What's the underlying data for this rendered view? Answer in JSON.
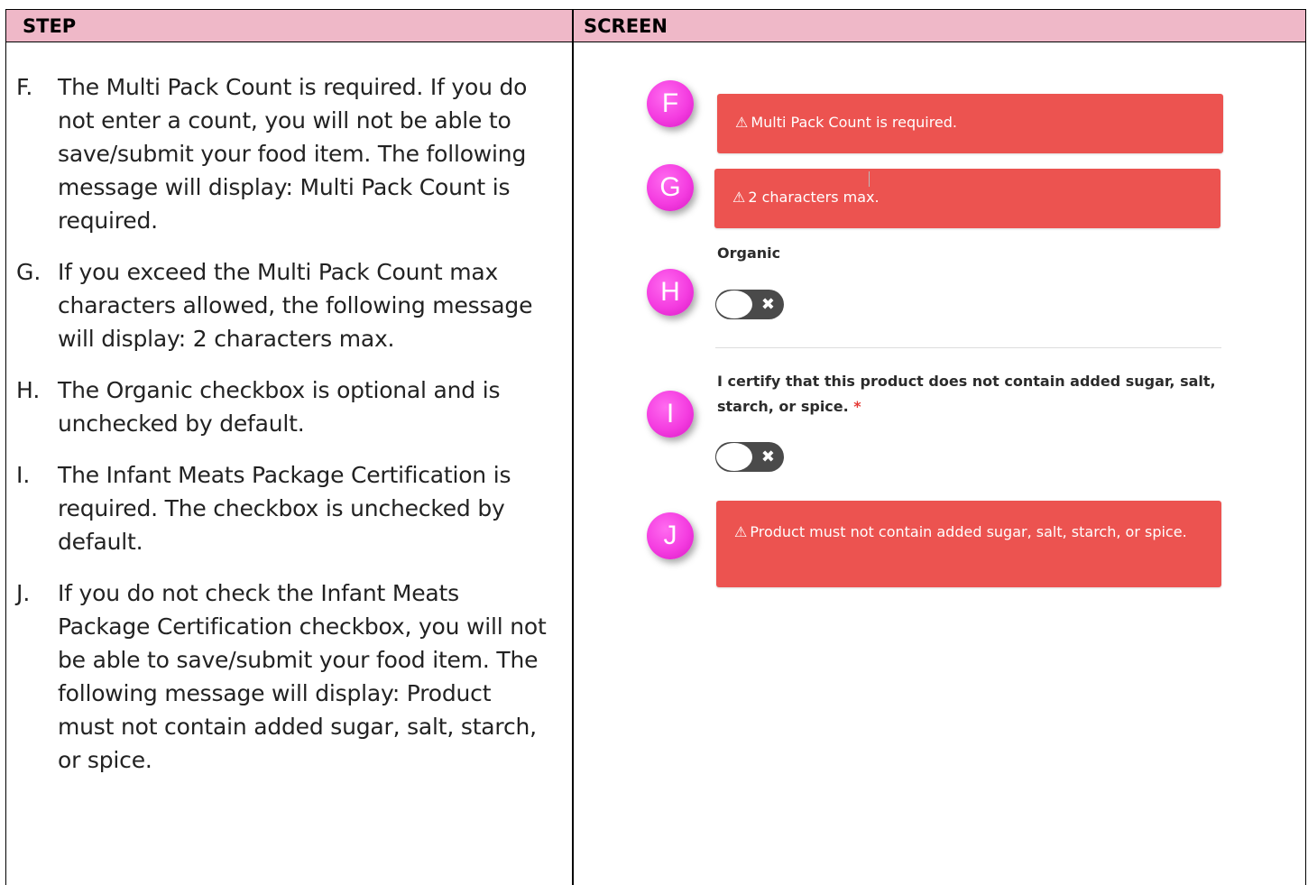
{
  "header": {
    "step": "STEP",
    "screen": "SCREEN"
  },
  "steps": [
    {
      "letter": "F.",
      "text": "The Multi Pack Count is required. If you do not enter a count, you will not be able to save/submit your food item. The following message will display:  Multi Pack Count is required."
    },
    {
      "letter": "G.",
      "text": "If you exceed the Multi Pack Count max characters allowed, the following message will display:  2 characters max."
    },
    {
      "letter": "H.",
      "text": "The Organic checkbox is optional and is unchecked by default."
    },
    {
      "letter": "I.",
      "text": "The Infant Meats Package Certification is required.  The checkbox is unchecked by default."
    },
    {
      "letter": "J.",
      "text": "If you do not check the Infant Meats Package Certification checkbox, you will not be able to save/submit your food item.  The following message will display: Product must not contain added sugar, salt, starch, or spice."
    }
  ],
  "screen": {
    "badges": [
      "F",
      "G",
      "H",
      "I",
      "J"
    ],
    "alerts": {
      "multi_pack_required": "Multi Pack Count is required.",
      "chars_max": "2 characters max.",
      "certification": "Product must not contain added sugar, salt, starch, or spice."
    },
    "warning_icon": "warning-triangle-icon",
    "organic_label": "Organic",
    "certify_label": "I certify that this product does not contain added sugar, salt, starch, or spice.",
    "required_mark": "*",
    "toggle_off_glyph": "✖",
    "colors": {
      "alert_bg": "#ec5350",
      "badge": "#f43ce0",
      "header_bg": "#efb8c8"
    }
  }
}
